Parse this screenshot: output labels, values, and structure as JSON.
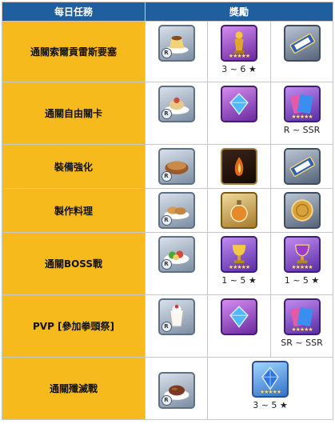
{
  "header": {
    "task": "每日任務",
    "reward": "獎勵"
  },
  "rows": [
    {
      "task": "通關索爾貢雷斯要塞",
      "rewards": [
        {
          "icon": "pudding-icon",
          "badge": "R",
          "caption": ""
        },
        {
          "icon": "golden-statue-icon",
          "caption": "3 ~ 6 ★"
        },
        {
          "icon": "ticket-icon",
          "caption": ""
        }
      ]
    },
    {
      "task": "通關自由關卡",
      "rewards": [
        {
          "icon": "cake-dish-icon",
          "badge": "R",
          "caption": ""
        },
        {
          "icon": "blue-crystal-icon",
          "caption": ""
        },
        {
          "icon": "card-pack-icon",
          "caption": "R ~ SSR"
        }
      ]
    },
    {
      "task": "裝備強化",
      "rewards": [
        {
          "icon": "pie-icon",
          "badge": "R",
          "caption": ""
        },
        {
          "icon": "fire-stone-icon",
          "caption": ""
        },
        {
          "icon": "ticket-icon",
          "caption": ""
        }
      ]
    },
    {
      "task": "製作料理",
      "rewards": [
        {
          "icon": "bread-icon",
          "badge": "R",
          "caption": ""
        },
        {
          "icon": "potion-icon",
          "caption": ""
        },
        {
          "icon": "gold-coin-icon",
          "caption": ""
        }
      ]
    },
    {
      "task": "通關BOSS戰",
      "rewards": [
        {
          "icon": "salad-icon",
          "badge": "R",
          "caption": ""
        },
        {
          "icon": "golden-goblet-icon",
          "caption": "1 ~ 5 ★"
        },
        {
          "icon": "purple-goblet-icon",
          "caption": "1 ~ 5 ★"
        }
      ]
    },
    {
      "task": "PVP [參加拳頭祭]",
      "rewards": [
        {
          "icon": "parfait-icon",
          "badge": "R",
          "caption": ""
        },
        {
          "icon": "blue-crystal-icon",
          "caption": ""
        },
        {
          "icon": "card-pack-icon",
          "caption": "SR ~ SSR"
        }
      ]
    },
    {
      "task": "通關殲滅戰",
      "rewards": [
        {
          "icon": "steak-icon",
          "badge": "R",
          "caption": ""
        },
        {
          "icon": "blue-gem-icon",
          "caption": "3 ~ 5 ★"
        }
      ]
    }
  ]
}
